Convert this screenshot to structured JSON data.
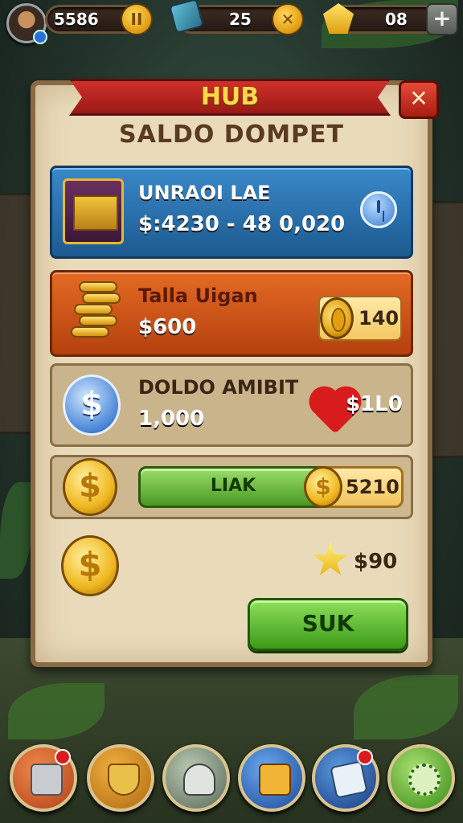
{
  "topbar": {
    "coins_value": "5586",
    "gems_value": "25",
    "stars_value": "08",
    "coin_button_glyph": "II",
    "gem_button_glyph": "✕",
    "plus_glyph": "+"
  },
  "panel": {
    "banner_title": "HUB",
    "close_glyph": "✕",
    "heading": "SALDO DOMPET"
  },
  "rows": [
    {
      "title": "UNRAOI LAE",
      "value": "$:4230 - 48 0,020",
      "icon": "treasure-chest-icon",
      "action_icon": "clock-icon"
    },
    {
      "title": "Talla Uigan",
      "value": "$600",
      "icon": "coin-stack-icon",
      "side_value": "140",
      "side_icon": "gold-ring-coin-icon"
    },
    {
      "title": "DOLDO AMIBIT",
      "value": "1,000",
      "icon": "silver-dollar-coin-icon",
      "side_value": "$1L0",
      "side_icon": "heart-icon"
    },
    {
      "bar_label": "LIAK",
      "side_value": "5210",
      "icon": "gold-dollar-coin-icon"
    },
    {
      "side_value": "$90",
      "icon": "gold-dollar-coin-icon",
      "side_icon": "star-icon"
    }
  ],
  "confirm_button": "SUK",
  "bottom_nav": [
    {
      "icon": "inventory-box-icon"
    },
    {
      "icon": "quest-shield-icon"
    },
    {
      "icon": "character-icon"
    },
    {
      "icon": "shop-dollar-icon"
    },
    {
      "icon": "mail-icon"
    },
    {
      "icon": "settings-gear-icon"
    }
  ],
  "colors": {
    "banner_red": "#c0281f",
    "title_gold": "#ffd84a",
    "row_blue": "#2a72b0",
    "row_orange": "#d0561a",
    "confirm_green": "#5cb82e"
  }
}
